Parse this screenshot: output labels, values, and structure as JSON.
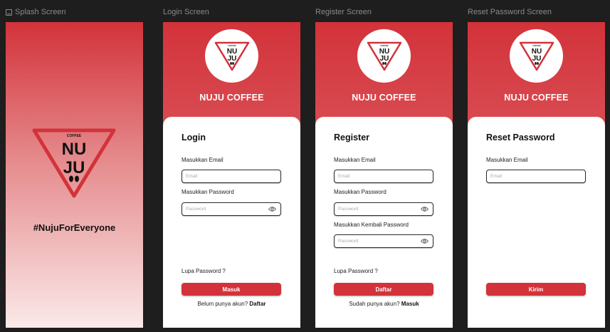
{
  "frames": {
    "splash": "Splash Screen",
    "login": "Login Screen",
    "register": "Register Screen",
    "reset": "Reset Password Screen"
  },
  "brand": {
    "name": "NUJU COFFEE",
    "logo_small": "COFFEE",
    "logo_line1": "NU",
    "logo_line2": "JU"
  },
  "colors": {
    "primary": "#d3323a",
    "canvas": "#1e1e1e"
  },
  "splash": {
    "hashtag": "#NujuForEveryone"
  },
  "login": {
    "title": "Login",
    "email_label": "Masukkan Email",
    "email_placeholder": "Email",
    "password_label": "Masukkan Password",
    "password_placeholder": "Password",
    "forgot": "Lupa Password ?",
    "button": "Masuk",
    "footer_text": "Belum punya akun?",
    "footer_link": "Daftar"
  },
  "register": {
    "title": "Register",
    "email_label": "Masukkan Email",
    "email_placeholder": "Email",
    "password_label": "Masukkan Password",
    "password_placeholder": "Password",
    "confirm_label": "Masukkan Kembali Password",
    "confirm_placeholder": "Password",
    "forgot": "Lupa Password ?",
    "button": "Daftar",
    "footer_text": "Sudah punya akun?",
    "footer_link": "Masuk"
  },
  "reset": {
    "title": "Reset Password",
    "email_label": "Masukkan Email",
    "email_placeholder": "Email",
    "button": "Kirim"
  },
  "icons": {
    "frame": "frame-icon",
    "eye": "eye-icon",
    "logo": "nuju-logo-icon"
  }
}
